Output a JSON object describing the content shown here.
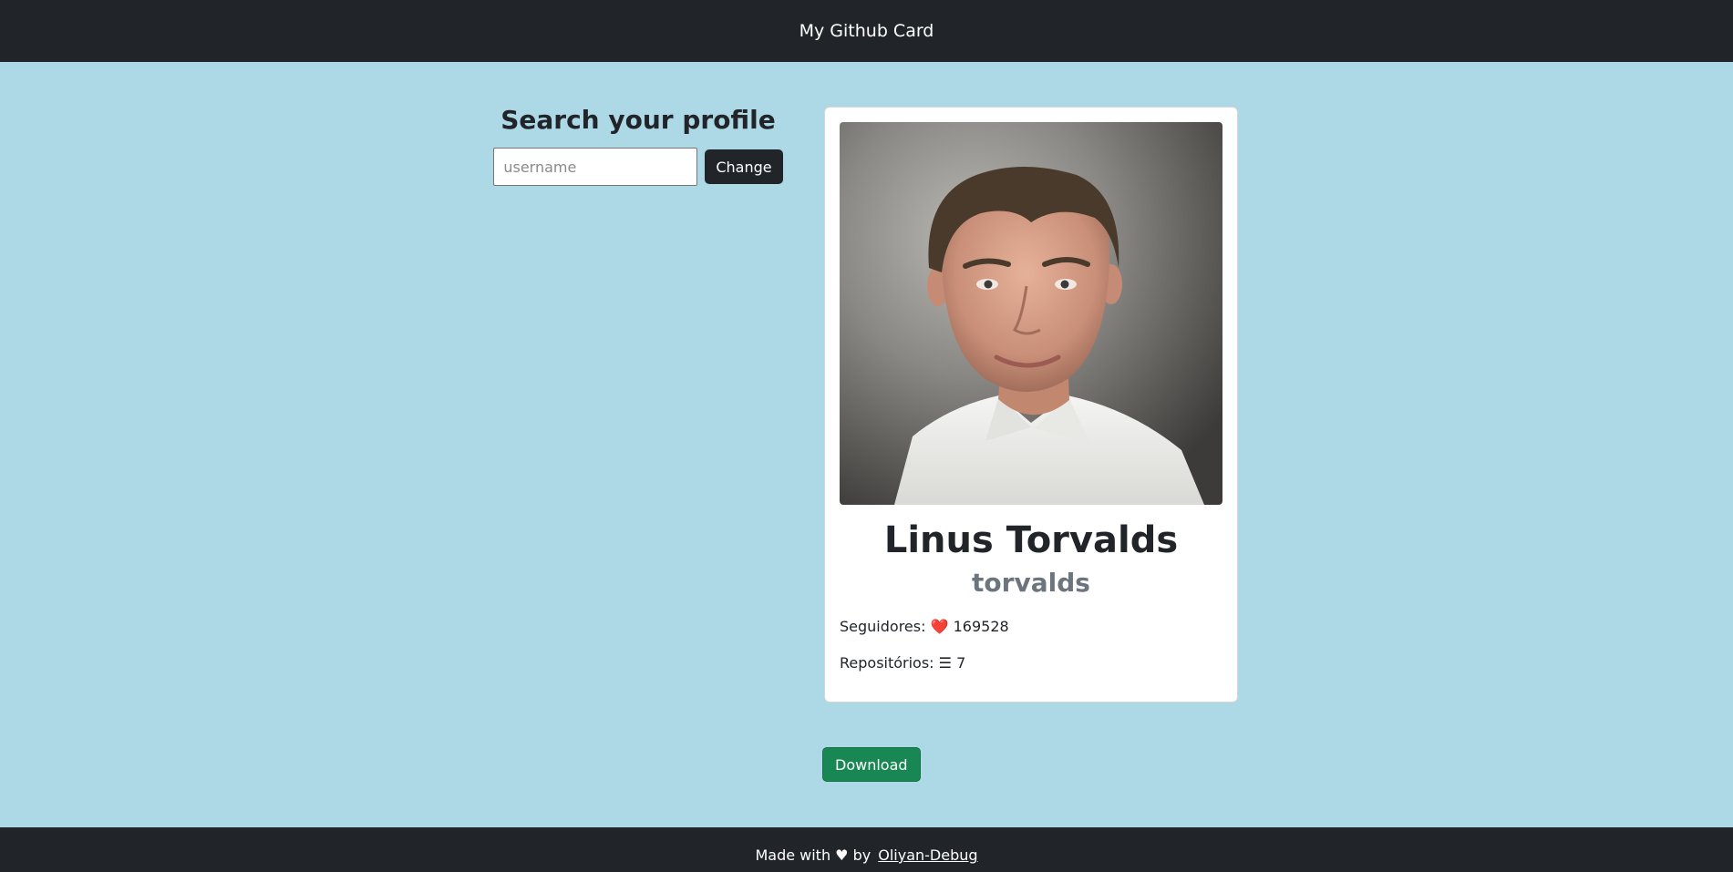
{
  "header": {
    "title": "My Github Card"
  },
  "search": {
    "title": "Search your profile",
    "placeholder": "username",
    "value": "",
    "button_label": "Change"
  },
  "card": {
    "avatar_icon": "avatar-photo",
    "name": "Linus Torvalds",
    "login": "torvalds",
    "followers": {
      "label": "Seguidores:",
      "icon": "❤️",
      "value": "169528"
    },
    "repos": {
      "label": "Repositórios:",
      "icon": "☰",
      "value": "7"
    }
  },
  "download": {
    "label": "Download"
  },
  "footer": {
    "text": "Made with ♥ by",
    "author_link": "Oliyan-Debug"
  },
  "colors": {
    "page_bg": "#add8e6",
    "header_bg": "#212529",
    "download_bg": "#198754",
    "muted_text": "#6c757d"
  }
}
